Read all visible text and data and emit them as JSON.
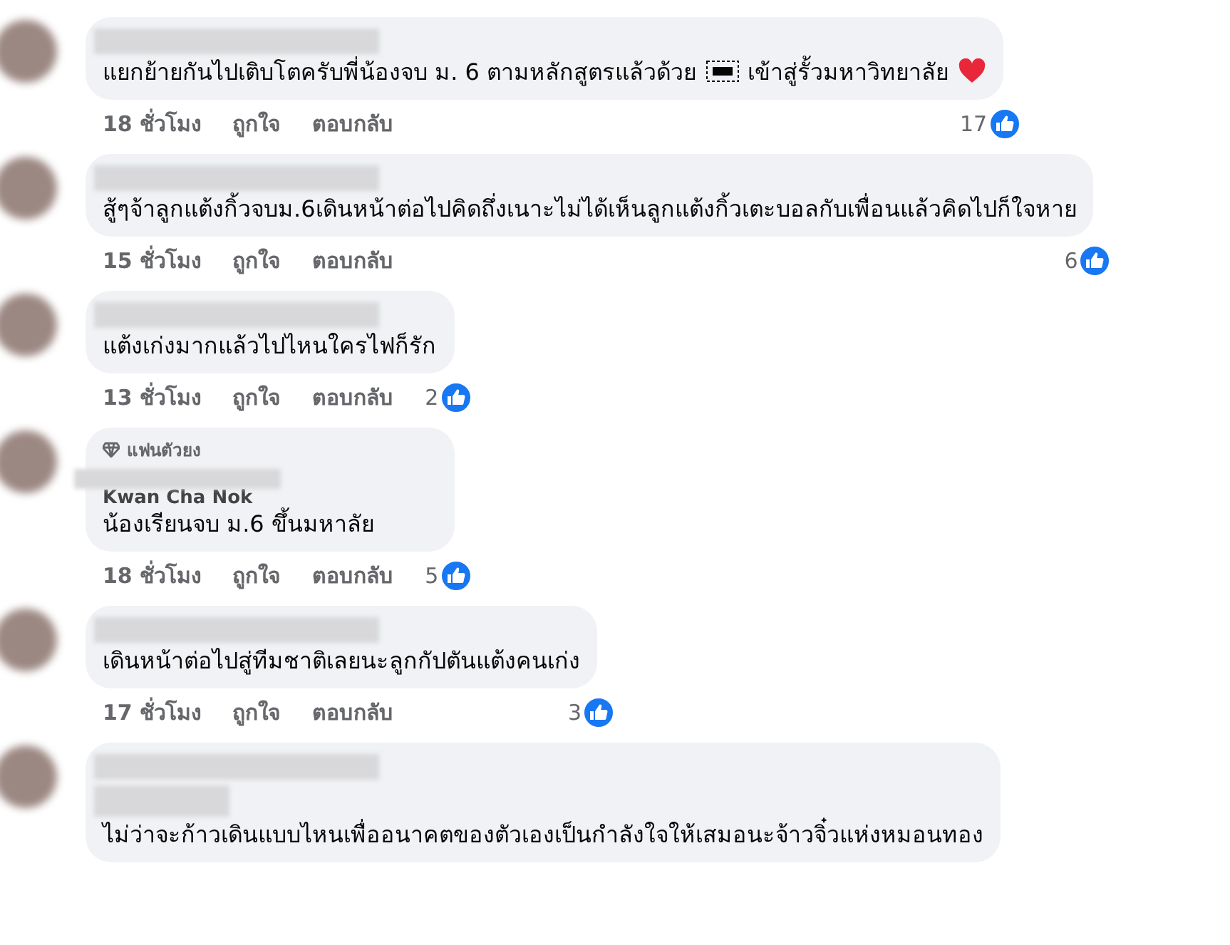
{
  "comments": [
    {
      "text": "แยกย้ายกันไปเติบโตครับพี่น้องจบ ม. 6 ตามหลักสูตรแล้วด้วย",
      "text_end": "เข้าสู่รั้วมหาวิทยาลัย",
      "heart": true,
      "time": "18 ชั่วโมง",
      "like": "ถูกใจ",
      "reply": "ตอบกลับ",
      "reactions": "17"
    },
    {
      "text": "สู้ๆจ้าลูกแต้งกิ้วจบม.6เดินหน้าต่อไปคิดถึ่งเนาะไม่ได้เห็นลูกแต้งกิ้วเตะบอลกับเพื่อนแล้วคิดไปก็ใจหาย",
      "time": "15 ชั่วโมง",
      "like": "ถูกใจ",
      "reply": "ตอบกลับ",
      "reactions": "6"
    },
    {
      "text": "แต้งเก่งมากแล้วไปไหนใครไฟก็รัก",
      "time": "13 ชั่วโมง",
      "like": "ถูกใจ",
      "reply": "ตอบกลับ",
      "reactions": "2"
    },
    {
      "badge": "แฟนตัวยง",
      "author": "Kwan Cha Nok",
      "text": "น้องเรียนจบ ม.6 ขึ้นมหาลัย",
      "time": "18 ชั่วโมง",
      "like": "ถูกใจ",
      "reply": "ตอบกลับ",
      "reactions": "5"
    },
    {
      "text": "เดินหน้าต่อไปสู่ทีมชาติเลยนะลูกกัปตันแต้งคนเก่ง",
      "time": "17 ชั่วโมง",
      "like": "ถูกใจ",
      "reply": "ตอบกลับ",
      "reactions": "3"
    },
    {
      "text": "ไม่ว่าจะก้าวเดินแบบไหนเพื่ออนาคตของตัวเองเป็นกำลังใจให้เสมอนะจ้าวจิ๋วแห่งหมอนทอง"
    }
  ]
}
